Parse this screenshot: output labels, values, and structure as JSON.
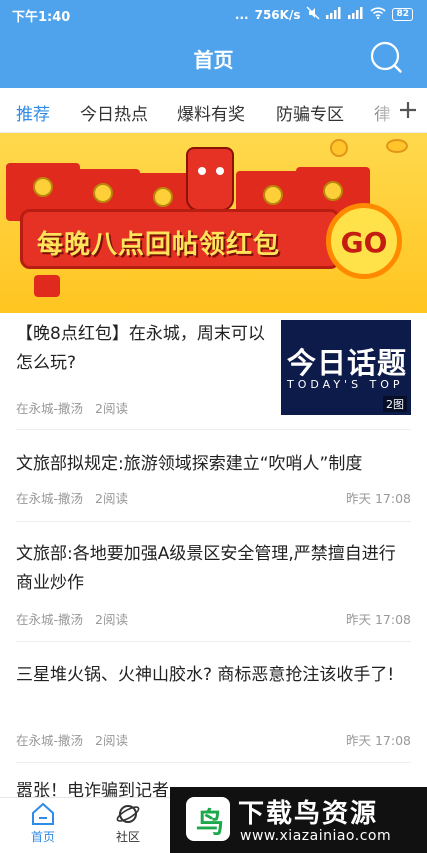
{
  "status": {
    "time": "下午1:40",
    "dots": "...",
    "speed": "756K/s",
    "battery": "82"
  },
  "header": {
    "title": "首页"
  },
  "tabs": [
    {
      "label": "推荐",
      "active": true
    },
    {
      "label": "今日热点"
    },
    {
      "label": "爆料有奖"
    },
    {
      "label": "防骗专区"
    },
    {
      "label": "律"
    }
  ],
  "banner": {
    "slogan": "每晚八点回帖领红包",
    "go_label": "GO"
  },
  "articles": [
    {
      "title": "【晚8点红包】在永城，周末可以怎么玩?",
      "source": "在永城-撒汤",
      "reads": "2阅读",
      "time": "",
      "thumb": {
        "title": "今日话题",
        "subtitle": "TODAY'S TOP",
        "badge": "2图"
      }
    },
    {
      "title": "文旅部拟规定:旅游领域探索建立“吹哨人”制度",
      "source": "在永城-撒汤",
      "reads": "2阅读",
      "time": "昨天 17:08"
    },
    {
      "title": "文旅部:各地要加强A级景区安全管理,严禁擅自进行商业炒作",
      "source": "在永城-撒汤",
      "reads": "2阅读",
      "time": "昨天 17:08"
    },
    {
      "title": "三星堆火锅、火神山胶水? 商标恶意抢注该收手了!",
      "source": "在永城-撒汤",
      "reads": "2阅读",
      "time": "昨天 17:08"
    },
    {
      "title": "嚣张！电诈骗到记者",
      "source": "",
      "reads": "",
      "time": ""
    }
  ],
  "bottom_nav": [
    {
      "label": "首页",
      "icon": "home-icon",
      "active": true
    },
    {
      "label": "社区",
      "icon": "planet-icon"
    }
  ],
  "watermark": {
    "logo_char": "鸟",
    "title": "下载鸟资源",
    "url": "www.xiazainiao.com"
  },
  "colors": {
    "header": "#4fa3ec",
    "accent": "#2f8be6",
    "banner": "#ffd94d",
    "envelope": "#e02a1e"
  }
}
